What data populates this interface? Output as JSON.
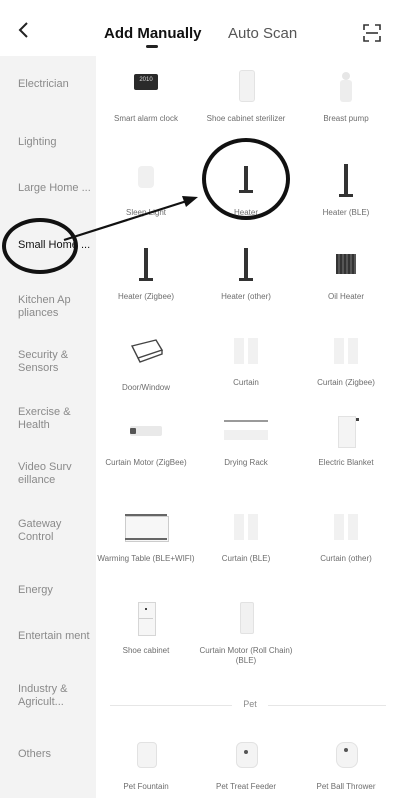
{
  "header": {
    "tab_active": "Add Manually",
    "tab_inactive": "Auto Scan",
    "back_icon": "chevron-left-icon",
    "scan_icon": "scan-frame-icon"
  },
  "sidebar": {
    "items": [
      {
        "label": "Electrician"
      },
      {
        "label": "Lighting"
      },
      {
        "label": "Large Home ..."
      },
      {
        "label": "Small Home ..."
      },
      {
        "label": "Kitchen Ap pliances"
      },
      {
        "label": "Security & Sensors"
      },
      {
        "label": "Exercise & Health"
      },
      {
        "label": "Video Surv eillance"
      },
      {
        "label": "Gateway Control"
      },
      {
        "label": "Energy"
      },
      {
        "label": "Entertain ment"
      },
      {
        "label": "Industry & Agricult..."
      },
      {
        "label": "Others"
      }
    ],
    "active_index": 3
  },
  "devices": [
    {
      "label": "Smart alarm clock",
      "badge": "2010"
    },
    {
      "label": "Shoe cabinet sterilizer"
    },
    {
      "label": "Breast pump"
    },
    {
      "label": "Sleep Light"
    },
    {
      "label": "Heater"
    },
    {
      "label": "Heater (BLE)"
    },
    {
      "label": "Heater (Zigbee)"
    },
    {
      "label": "Heater (other)"
    },
    {
      "label": "Oil Heater"
    },
    {
      "label": "Door/Window"
    },
    {
      "label": "Curtain"
    },
    {
      "label": "Curtain (Zigbee)"
    },
    {
      "label": "Curtain Motor (ZigBee)"
    },
    {
      "label": "Drying Rack"
    },
    {
      "label": "Electric Blanket"
    },
    {
      "label": "Warming Table (BLE+WIFI)"
    },
    {
      "label": "Curtain (BLE)"
    },
    {
      "label": "Curtain (other)"
    },
    {
      "label": "Shoe cabinet"
    },
    {
      "label": "Curtain Motor (Roll Chain) (BLE)"
    }
  ],
  "pet_section": {
    "title": "Pet",
    "devices": [
      {
        "label": "Pet Fountain"
      },
      {
        "label": "Pet Treat Feeder"
      },
      {
        "label": "Pet Ball Thrower"
      }
    ]
  }
}
